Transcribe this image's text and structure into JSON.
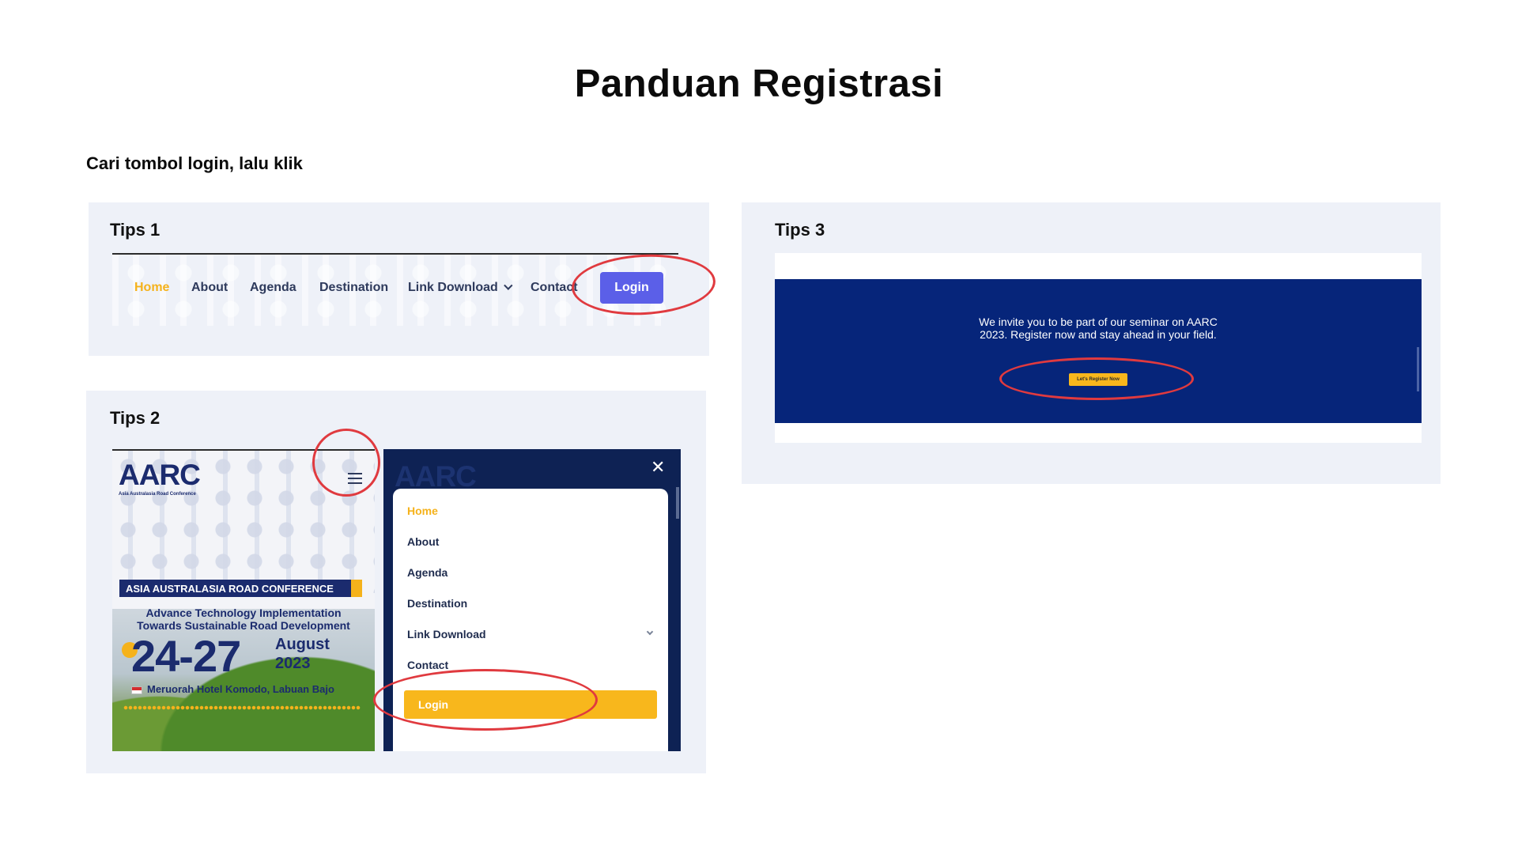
{
  "page": {
    "title": "Panduan Registrasi",
    "subtitle": "Cari tombol login, lalu klik"
  },
  "colors": {
    "accent_red": "#e03a3f",
    "brand_navy": "#1b2b6e",
    "brand_yellow": "#f5b21b",
    "login_blue": "#5b5fe8",
    "card_bg": "#eef1f8"
  },
  "tips1": {
    "title": "Tips 1",
    "nav": {
      "home": "Home",
      "about": "About",
      "agenda": "Agenda",
      "destination": "Destination",
      "link_download": "Link Download",
      "contact": "Contact",
      "login": "Login"
    }
  },
  "tips2": {
    "title": "Tips 2",
    "mobile": {
      "logo": "AARC",
      "logo_tagline": "Asia Australasia Road Conference",
      "banner": "ASIA AUSTRALASIA ROAD CONFERENCE",
      "headline_1": "Advance Technology Implementation",
      "headline_2": "Towards Sustainable Road Development",
      "dates": "24-27",
      "month": "August",
      "year": "2023",
      "venue": "Meruorah Hotel Komodo, Labuan Bajo"
    },
    "menu": {
      "logo": "AARC",
      "close": "✕",
      "items": {
        "home": "Home",
        "about": "About",
        "agenda": "Agenda",
        "destination": "Destination",
        "link_download": "Link Download",
        "contact": "Contact"
      },
      "login": "Login"
    }
  },
  "tips3": {
    "title": "Tips 3",
    "hero_text": "We invite you to be part of our seminar on AARC 2023. Register now and stay ahead in your field.",
    "register_button": "Let's Register Now"
  }
}
